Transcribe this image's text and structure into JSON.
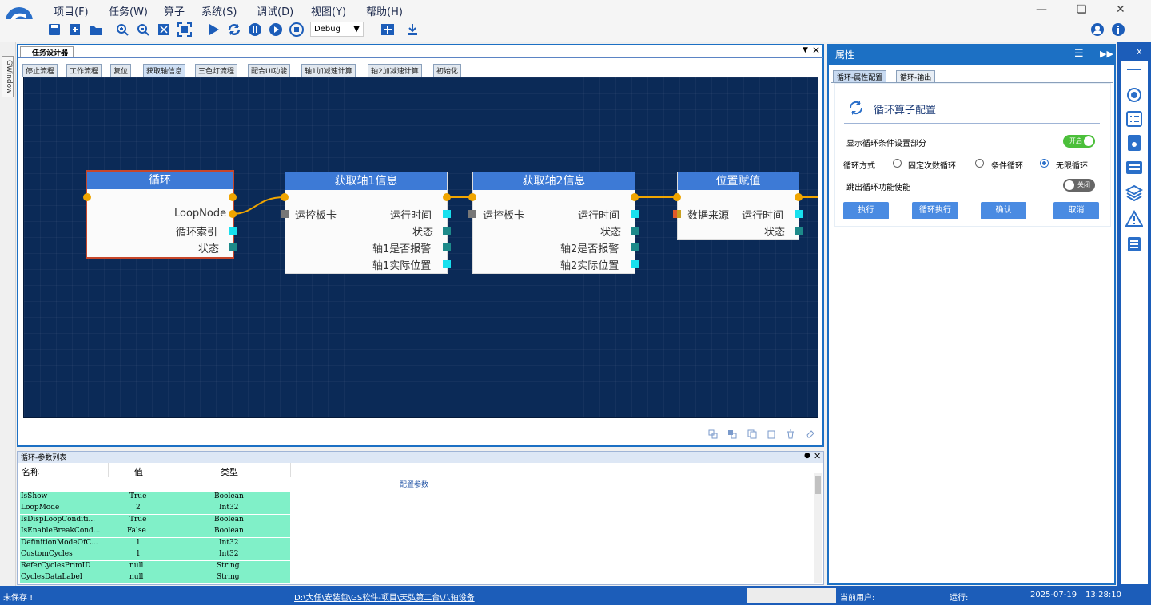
{
  "menu": [
    "项目(F)",
    "任务(W)",
    "算子",
    "系统(S)",
    "调试(D)",
    "视图(Y)",
    "帮助(H)"
  ],
  "toolbar": {
    "build_config": "Debug"
  },
  "left_strip": {
    "tab": "GWindow"
  },
  "designer": {
    "tab": "任务设计器",
    "subtabs": [
      "停止流程",
      "工作流程",
      "复位",
      "获取轴信息",
      "三色灯流程",
      "配合UI功能",
      "轴1加减速计算",
      "轴2加减速计算",
      "初始化"
    ],
    "nodes": {
      "loop": {
        "title": "循环",
        "outputs": [
          "LoopNode",
          "循环索引",
          "状态"
        ]
      },
      "axis1": {
        "title": "获取轴1信息",
        "input": "运控板卡",
        "outputs": [
          "运行时间",
          "状态",
          "轴1是否报警",
          "轴1实际位置"
        ]
      },
      "axis2": {
        "title": "获取轴2信息",
        "input": "运控板卡",
        "outputs": [
          "运行时间",
          "状态",
          "轴2是否报警",
          "轴2实际位置"
        ]
      },
      "assign": {
        "title": "位置赋值",
        "input": "数据来源",
        "outputs": [
          "运行时间",
          "状态"
        ]
      }
    }
  },
  "params": {
    "title": "循环-参数列表",
    "headers": [
      "名称",
      "值",
      "类型"
    ],
    "group": "配置参数",
    "rows": [
      [
        "IsShow",
        "True",
        "Boolean"
      ],
      [
        "LoopMode",
        "2",
        "Int32"
      ],
      [
        "IsDispLoopConditi...",
        "True",
        "Boolean"
      ],
      [
        "IsEnableBreakCond...",
        "False",
        "Boolean"
      ],
      [
        "DefinitionModeOfC...",
        "1",
        "Int32"
      ],
      [
        "CustomCycles",
        "1",
        "Int32"
      ],
      [
        "ReferCyclesPrimID",
        "null",
        "String"
      ],
      [
        "CyclesDataLabel",
        "null",
        "String"
      ]
    ]
  },
  "props": {
    "title": "属性",
    "tabs": [
      "循环-属性配置",
      "循环-输出"
    ],
    "heading": "循环算子配置",
    "show_condition_label": "显示循环条件设置部分",
    "show_condition_toggle": "开启",
    "loop_mode_label": "循环方式",
    "loop_modes": [
      "固定次数循环",
      "条件循环",
      "无限循环"
    ],
    "loop_mode_selected": 2,
    "break_label": "跳出循环功能使能",
    "break_toggle": "关闭",
    "buttons": [
      "执行",
      "循环执行",
      "确认",
      "取消"
    ]
  },
  "rside": {
    "close": "x"
  },
  "status": {
    "saved": "未保存 !",
    "path": "D:\\大任\\安装包\\GS软件-项目\\天弘第二台\\八轴设备",
    "user_label": "当前用户:",
    "run_label": "运行:",
    "date": "2025-07-19",
    "time": "13:28:10"
  },
  "colors": {
    "accent": "#1c70c4",
    "canvas": "#0b2a57",
    "node_title": "#3d7ad6",
    "port": "#f0a500"
  }
}
